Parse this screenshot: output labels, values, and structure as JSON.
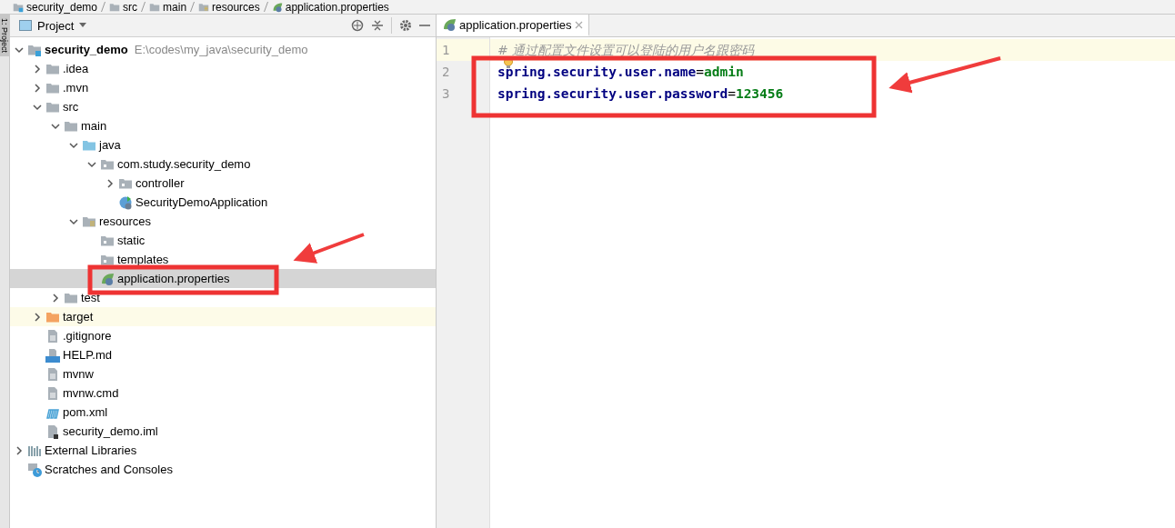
{
  "breadcrumbs": [
    {
      "label": "security_demo",
      "kind": "module"
    },
    {
      "label": "src",
      "kind": "folder"
    },
    {
      "label": "main",
      "kind": "folder"
    },
    {
      "label": "resources",
      "kind": "resources-folder"
    },
    {
      "label": "application.properties",
      "kind": "properties"
    }
  ],
  "side_strip": {
    "label": "1: Project"
  },
  "project_panel": {
    "title": "Project",
    "tree": [
      {
        "label": "security_demo",
        "path": "E:\\codes\\my_java\\security_demo",
        "kind": "module",
        "expanded": true,
        "selected": false,
        "children": [
          {
            "label": ".idea",
            "kind": "folder",
            "expanded": false,
            "selected": false
          },
          {
            "label": ".mvn",
            "kind": "folder",
            "expanded": false,
            "selected": false
          },
          {
            "label": "src",
            "kind": "folder",
            "expanded": true,
            "selected": false,
            "children": [
              {
                "label": "main",
                "kind": "folder",
                "expanded": true,
                "selected": false,
                "children": [
                  {
                    "label": "java",
                    "kind": "source-folder",
                    "expanded": true,
                    "selected": false,
                    "children": [
                      {
                        "label": "com.study.security_demo",
                        "kind": "package",
                        "expanded": true,
                        "selected": false,
                        "children": [
                          {
                            "label": "controller",
                            "kind": "package",
                            "expanded": false,
                            "selected": false
                          },
                          {
                            "label": "SecurityDemoApplication",
                            "kind": "spring-class",
                            "selected": false
                          }
                        ]
                      }
                    ]
                  },
                  {
                    "label": "resources",
                    "kind": "resources-folder",
                    "expanded": true,
                    "selected": false,
                    "children": [
                      {
                        "label": "static",
                        "kind": "package",
                        "selected": false
                      },
                      {
                        "label": "templates",
                        "kind": "package",
                        "selected": false
                      },
                      {
                        "label": "application.properties",
                        "kind": "properties",
                        "selected": true
                      }
                    ]
                  }
                ]
              },
              {
                "label": "test",
                "kind": "folder",
                "expanded": false,
                "selected": false
              }
            ]
          },
          {
            "label": "target",
            "kind": "excluded-folder",
            "expanded": false,
            "selected": false
          },
          {
            "label": ".gitignore",
            "kind": "file",
            "selected": false
          },
          {
            "label": "HELP.md",
            "kind": "markdown",
            "selected": false
          },
          {
            "label": "mvnw",
            "kind": "file",
            "selected": false
          },
          {
            "label": "mvnw.cmd",
            "kind": "file",
            "selected": false
          },
          {
            "label": "pom.xml",
            "kind": "maven",
            "selected": false
          },
          {
            "label": "security_demo.iml",
            "kind": "iml",
            "selected": false
          }
        ]
      },
      {
        "label": "External Libraries",
        "kind": "libraries",
        "expanded": false,
        "selected": false
      },
      {
        "label": "Scratches and Consoles",
        "kind": "scratches",
        "selected": false
      }
    ]
  },
  "editor": {
    "tabs": [
      {
        "label": "application.properties",
        "kind": "properties",
        "selected": true
      }
    ],
    "lines": [
      {
        "number": "1",
        "kind": "comment",
        "text": "# 通过配置文件设置可以登陆的用户名跟密码"
      },
      {
        "number": "2",
        "kind": "property",
        "key": "spring.security.user.name",
        "separator": "=",
        "value": "admin"
      },
      {
        "number": "3",
        "kind": "property",
        "key": "spring.security.user.password",
        "separator": "=",
        "value": "123456"
      }
    ]
  }
}
